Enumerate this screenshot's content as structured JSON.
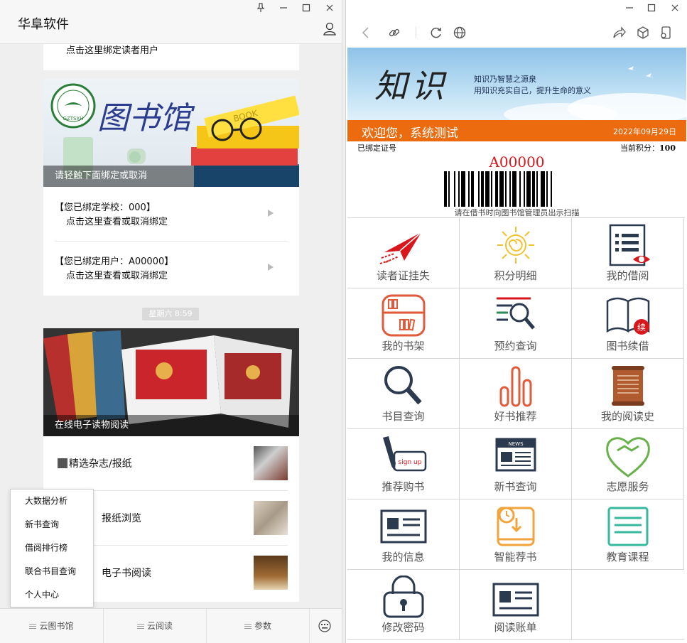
{
  "left": {
    "title": "华阜软件",
    "top_card_text": "点击这里绑定读者用户",
    "library_banner": {
      "logo_text": "GZTSXH",
      "heading": "图书馆",
      "book_text": "BOOK",
      "caption": "请轻触下面绑定或取消"
    },
    "bind_rows": [
      {
        "line1": "【您已绑定学校：000】",
        "line2": "点击这里查看或取消绑定"
      },
      {
        "line1": "【您已绑定用户：A00000】",
        "line2": "点击这里查看或取消绑定"
      }
    ],
    "time_chip": "星期六  8:59",
    "magazine_banner_caption": "在线电子读物阅读",
    "news_rows": [
      {
        "title": "精选杂志/报纸"
      },
      {
        "title": "报纸浏览"
      },
      {
        "title": "电子书阅读"
      }
    ],
    "popup_menu": [
      "大数据分析",
      "新书查询",
      "借阅排行榜",
      "联合书目查询",
      "个人中心"
    ],
    "bottom_tabs": [
      "云图书馆",
      "云阅读",
      "参数"
    ],
    "icons": {
      "pin": "pin-icon",
      "minimize": "minimize-icon",
      "maximize": "maximize-icon",
      "close": "close-icon",
      "user": "user-icon",
      "keyboard": "keyboard-icon",
      "newspaper": "newspaper-icon"
    }
  },
  "right": {
    "hero": {
      "big_word": "知识",
      "line1": "知识乃智慧之源泉",
      "line2": "用知识充实自己，提升生命的意义"
    },
    "welcome": "欢迎您，系统测试",
    "date": "2022年09月29日",
    "bound_label": "已绑定证号",
    "points_label": "当前积分：",
    "points_value": "100",
    "card_number": "A00000",
    "barcode_tip": "请在借书时向图书馆管理员出示扫描",
    "grid": [
      "读者证挂失",
      "积分明细",
      "我的借阅",
      "我的书架",
      "预约查询",
      "图书续借",
      "书目查询",
      "好书推荐",
      "我的阅读史",
      "推荐购书",
      "新书查询",
      "志愿服务",
      "我的信息",
      "智能荐书",
      "教育课程",
      "修改密码",
      "阅读账单"
    ],
    "grid_icon_text": {
      "renew_badge": "续",
      "signup": "sign up",
      "news": "NEWS"
    },
    "colors": {
      "orange": "#ec6b0e",
      "red": "#d9161c",
      "navy": "#2b3a4f",
      "amber": "#f1a33c",
      "green": "#6ab04c",
      "teal": "#35b99c",
      "brown": "#b05a30"
    }
  }
}
